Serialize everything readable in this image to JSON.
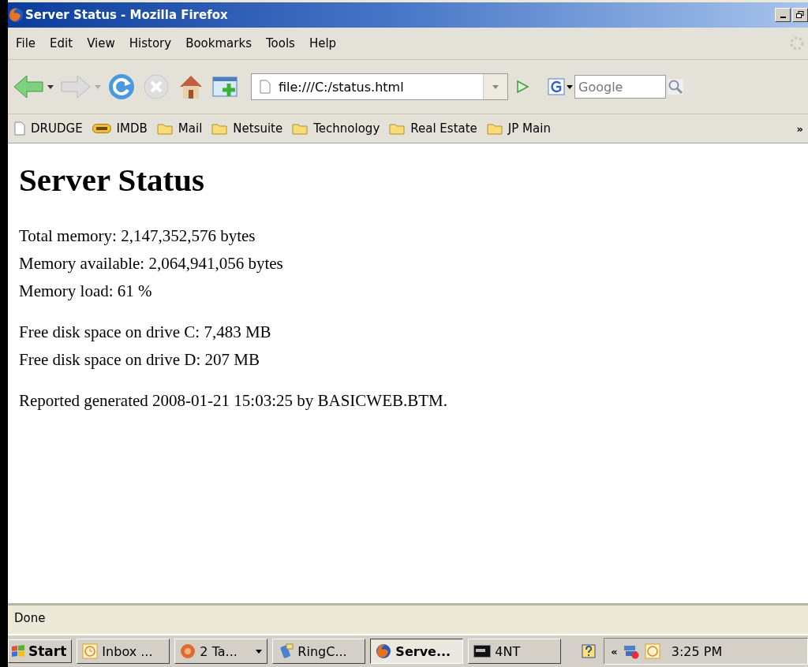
{
  "window": {
    "title": "Server Status - Mozilla Firefox"
  },
  "menu": [
    "File",
    "Edit",
    "View",
    "History",
    "Bookmarks",
    "Tools",
    "Help"
  ],
  "address": {
    "value": "file:///C:/status.html"
  },
  "search": {
    "placeholder": "Google"
  },
  "bookmarks": [
    {
      "label": "DRUDGE",
      "kind": "page"
    },
    {
      "label": "IMDB",
      "kind": "badge"
    },
    {
      "label": "Mail",
      "kind": "folder"
    },
    {
      "label": "Netsuite",
      "kind": "folder"
    },
    {
      "label": "Technology",
      "kind": "folder"
    },
    {
      "label": "Real Estate",
      "kind": "folder"
    },
    {
      "label": "JP Main",
      "kind": "folder"
    }
  ],
  "bookmarks_more": "»",
  "page": {
    "heading": "Server Status",
    "paragraphs": [
      [
        "Total memory: 2,147,352,576 bytes",
        "Memory available: 2,064,941,056 bytes",
        "Memory load: 61 %"
      ],
      [
        "Free disk space on drive C: 7,483 MB",
        "Free disk space on drive D: 207 MB"
      ],
      [
        "Reported generated 2008-01-21 15:03:25 by BASICWEB.BTM."
      ]
    ]
  },
  "status_bar": "Done",
  "taskbar": {
    "start": "Start",
    "items": [
      {
        "label": "Inbox ...",
        "kind": "clock",
        "selected": false,
        "grouped": false
      },
      {
        "label": "2 Ta...",
        "kind": "tc",
        "selected": false,
        "grouped": true
      },
      {
        "label": "RingC...",
        "kind": "phone",
        "selected": false,
        "grouped": false
      },
      {
        "label": "Serve...",
        "kind": "firefox",
        "selected": true,
        "grouped": false
      },
      {
        "label": "4NT",
        "kind": "console",
        "selected": false,
        "grouped": false
      }
    ],
    "tray_expand": "«",
    "time": "3:25 PM"
  }
}
